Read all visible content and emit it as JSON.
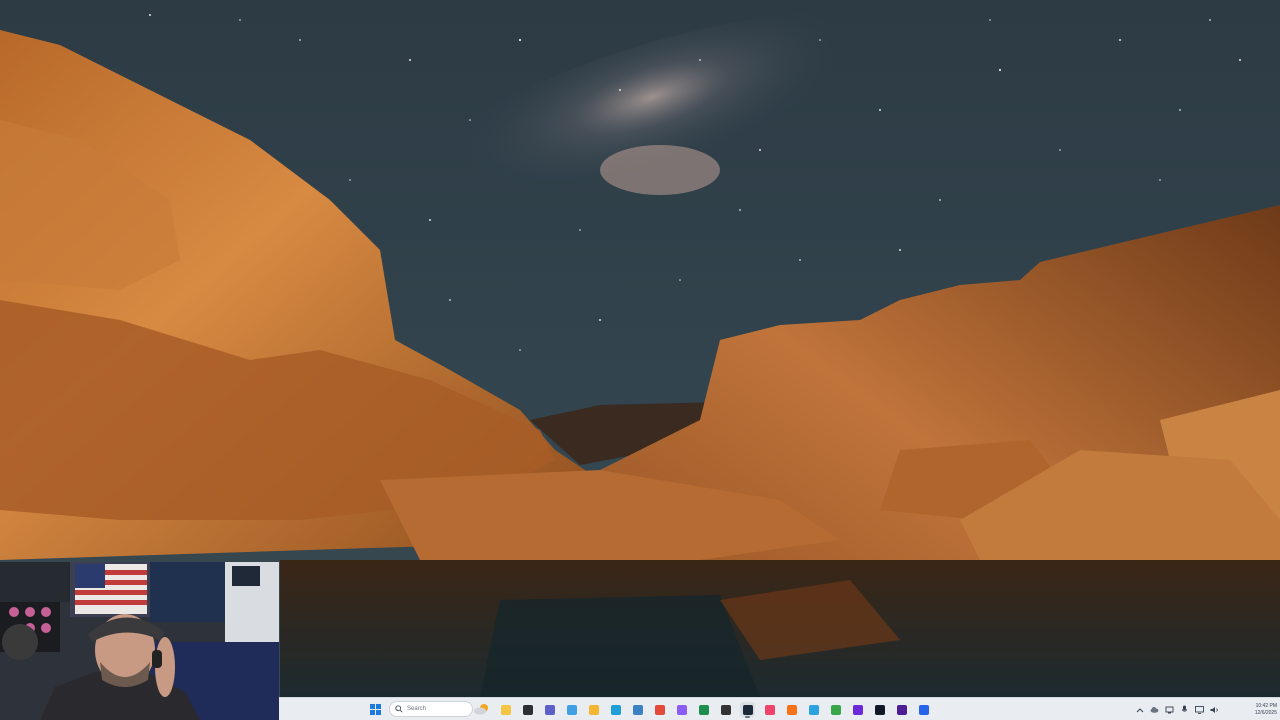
{
  "desktop": {
    "wallpaper_icon": "mountain-canyon-night-sky-icon"
  },
  "webcam": {
    "icon": "webcam-person-icon"
  },
  "taskbar": {
    "start_icon": "windows-start-icon",
    "search": {
      "placeholder": "Search",
      "icon": "search-icon"
    },
    "widget_icon": "weather-widget-icon",
    "apps": [
      {
        "name": "file-explorer",
        "icon": "folder-icon",
        "color": "#f4c542"
      },
      {
        "name": "terminal",
        "icon": "terminal-icon",
        "color": "#2b2f36"
      },
      {
        "name": "teams",
        "icon": "teams-icon",
        "color": "#5b5fc7"
      },
      {
        "name": "copilot",
        "icon": "copilot-icon",
        "color": "#3fa1e3"
      },
      {
        "name": "folder",
        "icon": "folder-icon",
        "color": "#f2b632"
      },
      {
        "name": "edge",
        "icon": "edge-icon",
        "color": "#1f9ed8"
      },
      {
        "name": "store",
        "icon": "store-icon",
        "color": "#3b82c4"
      },
      {
        "name": "chrome",
        "icon": "chrome-icon",
        "color": "#e34a3a"
      },
      {
        "name": "obs",
        "icon": "obs-icon",
        "color": "#8b5cf6"
      },
      {
        "name": "excel",
        "icon": "excel-icon",
        "color": "#1f8f4e"
      },
      {
        "name": "davinci",
        "icon": "davinci-icon",
        "color": "#333333"
      },
      {
        "name": "steam",
        "icon": "steam-icon",
        "color": "#1b2838"
      },
      {
        "name": "music",
        "icon": "music-icon",
        "color": "#f0436b"
      },
      {
        "name": "app-orange",
        "icon": "app-icon",
        "color": "#f97316"
      },
      {
        "name": "telegram",
        "icon": "telegram-icon",
        "color": "#2aa3e0"
      },
      {
        "name": "xbox",
        "icon": "xbox-icon",
        "color": "#3aa64a"
      },
      {
        "name": "circle-app",
        "icon": "app-icon",
        "color": "#6d28d9"
      },
      {
        "name": "video-app",
        "icon": "video-icon",
        "color": "#111827"
      },
      {
        "name": "premiere",
        "icon": "premiere-icon",
        "color": "#4c1d95"
      },
      {
        "name": "photos",
        "icon": "photos-icon",
        "color": "#2563eb"
      }
    ],
    "active_app": "steam"
  },
  "tray": {
    "icons": [
      "chevron-up-icon",
      "cloud-icon",
      "network-icon",
      "mic-icon",
      "display-icon",
      "speaker-icon"
    ],
    "time": "10:42 PM",
    "date": "12/6/2025",
    "notification_icon": "bell-icon"
  }
}
